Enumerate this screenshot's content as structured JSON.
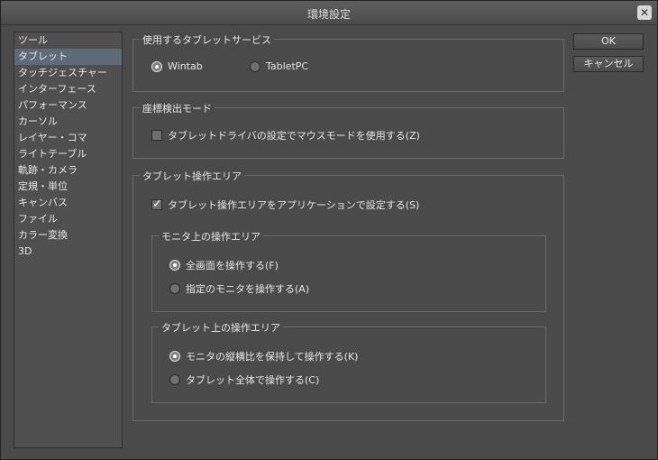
{
  "window": {
    "title": "環境設定",
    "close_symbol": "✕"
  },
  "sidebar": {
    "items": [
      {
        "label": "ツール",
        "selected": false
      },
      {
        "label": "タブレット",
        "selected": true
      },
      {
        "label": "タッチジェスチャー",
        "selected": false
      },
      {
        "label": "インターフェース",
        "selected": false
      },
      {
        "label": "パフォーマンス",
        "selected": false
      },
      {
        "label": "カーソル",
        "selected": false
      },
      {
        "label": "レイヤー・コマ",
        "selected": false
      },
      {
        "label": "ライトテーブル",
        "selected": false
      },
      {
        "label": "軌跡・カメラ",
        "selected": false
      },
      {
        "label": "定規・単位",
        "selected": false
      },
      {
        "label": "キャンバス",
        "selected": false
      },
      {
        "label": "ファイル",
        "selected": false
      },
      {
        "label": "カラー変換",
        "selected": false
      },
      {
        "label": "3D",
        "selected": false
      }
    ]
  },
  "tablet_service": {
    "label": "使用するタブレットサービス",
    "options": [
      {
        "label": "Wintab",
        "selected": true
      },
      {
        "label": "TabletPC",
        "selected": false
      }
    ]
  },
  "coord_mode": {
    "label": "座標検出モード",
    "checkbox": {
      "label": "タブレットドライバの設定でマウスモードを使用する(Z)",
      "checked": false
    }
  },
  "operation_area": {
    "label": "タブレット操作エリア",
    "checkbox": {
      "label": "タブレット操作エリアをアプリケーションで設定する(S)",
      "checked": true
    },
    "monitor_area": {
      "label": "モニタ上の操作エリア",
      "options": [
        {
          "label": "全画面を操作する(F)",
          "selected": true
        },
        {
          "label": "指定のモニタを操作する(A)",
          "selected": false
        }
      ]
    },
    "tablet_area": {
      "label": "タブレット上の操作エリア",
      "options": [
        {
          "label": "モニタの縦横比を保持して操作する(K)",
          "selected": true
        },
        {
          "label": "タブレット全体で操作する(C)",
          "selected": false
        }
      ]
    }
  },
  "buttons": {
    "ok": "OK",
    "cancel": "キャンセル"
  }
}
